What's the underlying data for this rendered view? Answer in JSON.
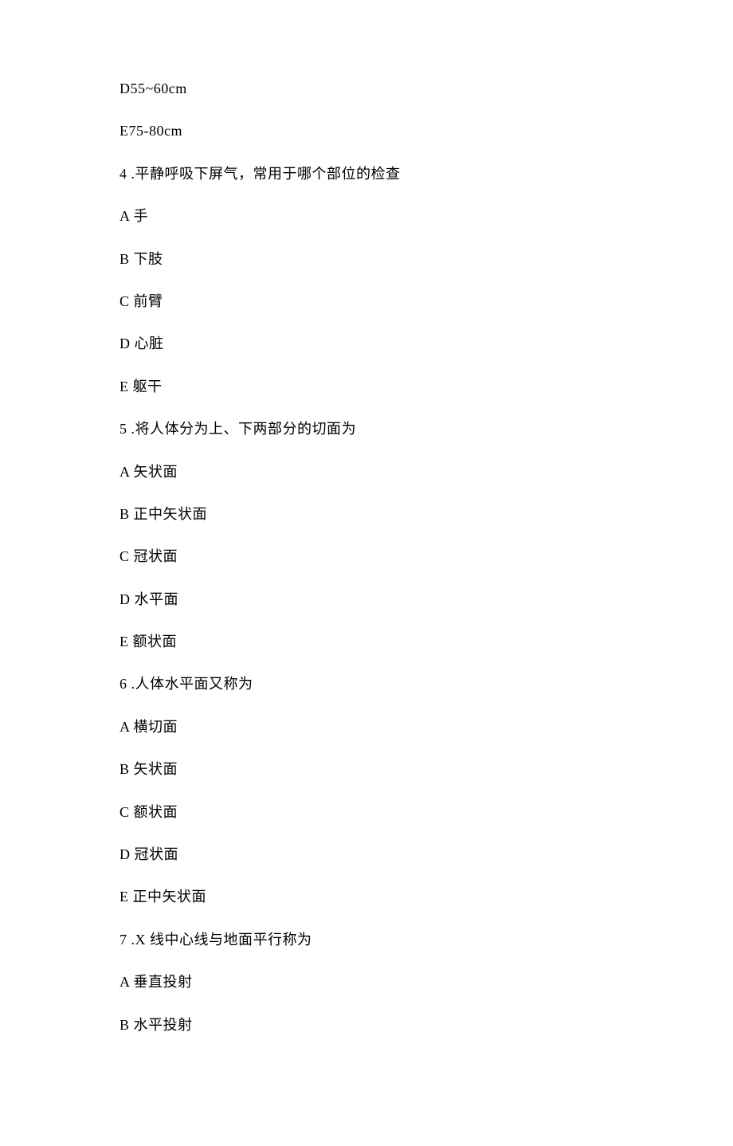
{
  "lines": [
    "D55~60cm",
    "E75-80cm",
    "4 .平静呼吸下屏气，常用于哪个部位的检查",
    "A 手",
    "B 下肢",
    "C 前臂",
    "D 心脏",
    "E 躯干",
    "5 .将人体分为上、下两部分的切面为",
    "A 矢状面",
    "B 正中矢状面",
    "C 冠状面",
    "D 水平面",
    "E 额状面",
    "6 .人体水平面又称为",
    "A 横切面",
    "B 矢状面",
    "C 额状面",
    "D 冠状面",
    "E 正中矢状面",
    "7 .X 线中心线与地面平行称为",
    "A 垂直投射",
    "B 水平投射"
  ]
}
